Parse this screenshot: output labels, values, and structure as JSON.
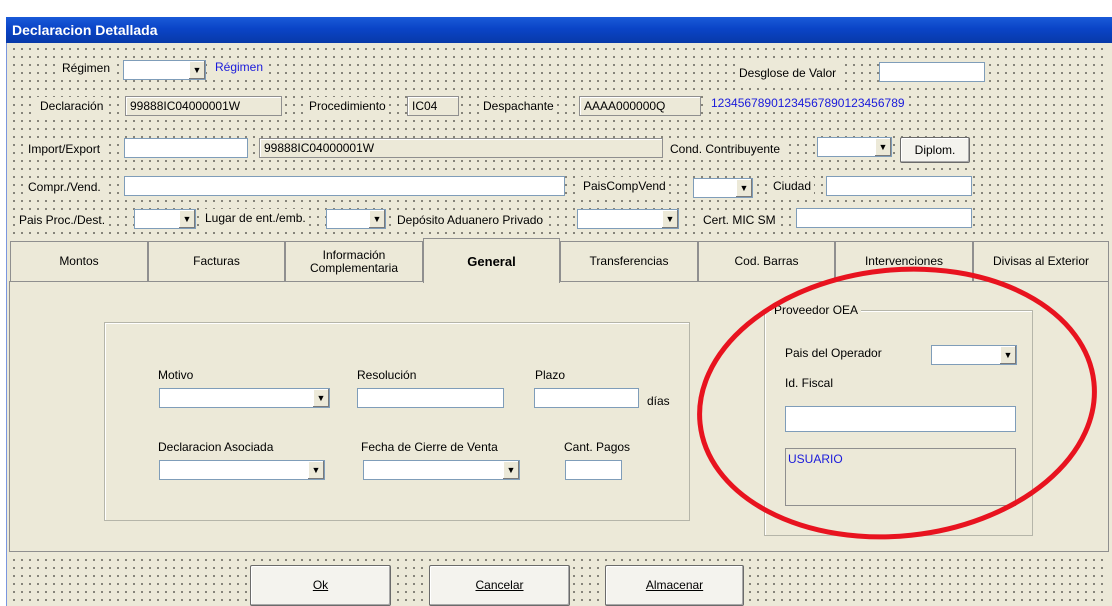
{
  "window": {
    "title": "Declaracion Detallada"
  },
  "header": {
    "regimen_label": "Régimen",
    "regimen_value": "",
    "regimen_link": "Régimen",
    "desglose_label": "Desglose de Valor",
    "desglose_value": "",
    "declaracion_label": "Declaración",
    "declaracion_value": "99888IC04000001W",
    "procedimiento_label": "Procedimiento",
    "procedimiento_value": "IC04",
    "despachante_label": "Despachante",
    "despachante_value": "AAAA000000Q",
    "despachante_number": "12345678901234567890123456789",
    "impexp_label": "Import/Export",
    "impexp_value": "",
    "impexp_ref": "99888IC04000001W",
    "cond_label": "Cond. Contribuyente",
    "cond_value": "",
    "diplom_button": "Diplom.",
    "comprvend_label": "Compr./Vend.",
    "comprvend_value": "",
    "paiscomp_label": "PaisCompVend",
    "paiscomp_value": "",
    "ciudad_label": "Ciudad",
    "ciudad_value": "",
    "paisproc_label": "Pais Proc./Dest.",
    "paisproc_value": "",
    "lugar_label": "Lugar de ent./emb.",
    "lugar_value": "",
    "deposito_label": "Depósito Aduanero Privado",
    "deposito_value": "",
    "cert_label": "Cert. MIC SM",
    "cert_value": ""
  },
  "tabs": [
    {
      "label": "Montos"
    },
    {
      "label": "Facturas"
    },
    {
      "label": "Información\nComplementaria"
    },
    {
      "label": "General"
    },
    {
      "label": "Transferencias"
    },
    {
      "label": "Cod. Barras"
    },
    {
      "label": "Intervenciones"
    },
    {
      "label": "Divisas al Exterior"
    }
  ],
  "general": {
    "motivo_label": "Motivo",
    "motivo_value": "",
    "resolucion_label": "Resolución",
    "resolucion_value": "",
    "plazo_label": "Plazo",
    "plazo_value": "",
    "dias_label": "días",
    "declaracion_asociada_label": "Declaracion Asociada",
    "declaracion_asociada_value": "",
    "fecha_cierre_label": "Fecha de Cierre de Venta",
    "fecha_cierre_value": "",
    "cant_pagos_label": "Cant. Pagos",
    "cant_pagos_value": ""
  },
  "proveedor": {
    "group_title": "Proveedor OEA",
    "pais_operador_label": "Pais del Operador",
    "pais_operador_value": "",
    "id_fiscal_label": "Id. Fiscal",
    "id_fiscal_value": "",
    "usuario_text": "USUARIO"
  },
  "footer": {
    "ok_label": "Ok",
    "cancel_label": "Cancelar",
    "store_label": "Almacenar"
  },
  "annotation": {
    "ellipse_color": "#e8131f"
  }
}
